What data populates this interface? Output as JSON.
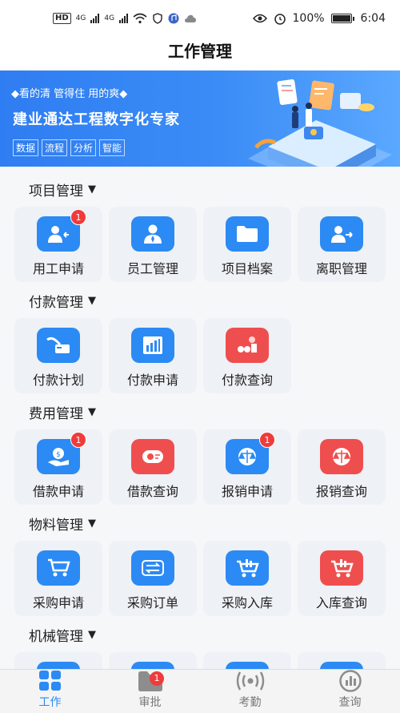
{
  "status": {
    "network": "HD",
    "signal1": "4G",
    "signal2": "4G",
    "battery": "100%",
    "time": "6:04"
  },
  "app": {
    "title": "工作管理"
  },
  "banner": {
    "tagline": "◆看的清 管得住 用的爽◆",
    "headline": "建业通达工程数字化专家",
    "chips": [
      "数据",
      "流程",
      "分析",
      "智能"
    ]
  },
  "sections": [
    {
      "title": "项目管理",
      "items": [
        {
          "label": "用工申请",
          "icon": "user-apply-icon",
          "color": "blue",
          "badge": "1"
        },
        {
          "label": "员工管理",
          "icon": "employee-icon",
          "color": "blue",
          "badge": ""
        },
        {
          "label": "项目档案",
          "icon": "folder-icon",
          "color": "blue",
          "badge": ""
        },
        {
          "label": "离职管理",
          "icon": "resign-icon",
          "color": "blue",
          "badge": ""
        }
      ]
    },
    {
      "title": "付款管理",
      "items": [
        {
          "label": "付款计划",
          "icon": "payment-plan-icon",
          "color": "blue",
          "badge": ""
        },
        {
          "label": "付款申请",
          "icon": "payment-apply-icon",
          "color": "blue",
          "badge": ""
        },
        {
          "label": "付款查询",
          "icon": "payment-query-icon",
          "color": "red",
          "badge": ""
        }
      ]
    },
    {
      "title": "费用管理",
      "items": [
        {
          "label": "借款申请",
          "icon": "loan-apply-icon",
          "color": "blue",
          "badge": "1"
        },
        {
          "label": "借款查询",
          "icon": "loan-query-icon",
          "color": "red",
          "badge": ""
        },
        {
          "label": "报销申请",
          "icon": "reimburse-apply-icon",
          "color": "blue",
          "badge": "1"
        },
        {
          "label": "报销查询",
          "icon": "reimburse-query-icon",
          "color": "red",
          "badge": ""
        }
      ]
    },
    {
      "title": "物料管理",
      "items": [
        {
          "label": "采购申请",
          "icon": "cart-icon",
          "color": "blue",
          "badge": ""
        },
        {
          "label": "采购订单",
          "icon": "order-icon",
          "color": "blue",
          "badge": ""
        },
        {
          "label": "采购入库",
          "icon": "cart-in-icon",
          "color": "blue",
          "badge": ""
        },
        {
          "label": "入库查询",
          "icon": "cart-query-icon",
          "color": "red",
          "badge": ""
        }
      ]
    },
    {
      "title": "机械管理",
      "items": []
    }
  ],
  "tabs": [
    {
      "label": "工作",
      "icon": "grid-icon",
      "active": true,
      "badge": ""
    },
    {
      "label": "审批",
      "icon": "folder-tab-icon",
      "active": false,
      "badge": "1"
    },
    {
      "label": "考勤",
      "icon": "signal-icon",
      "active": false,
      "badge": ""
    },
    {
      "label": "查询",
      "icon": "chart-icon",
      "active": false,
      "badge": ""
    }
  ],
  "colors": {
    "accent": "#2b8af4",
    "red": "#ef4e4e",
    "badge": "#ef3b3b"
  }
}
